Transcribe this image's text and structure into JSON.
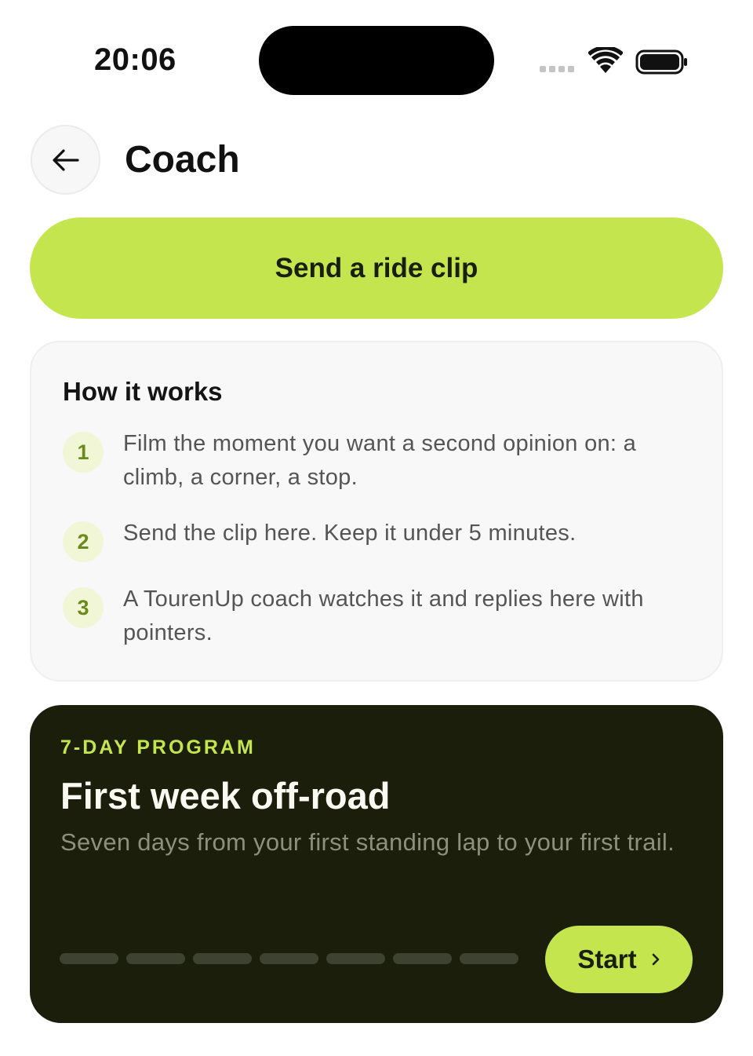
{
  "status_bar": {
    "time": "20:06",
    "signal_icon": "signal-dots-icon",
    "wifi_icon": "wifi-icon",
    "battery_icon": "battery-full-icon"
  },
  "header": {
    "back_icon": "arrow-left-icon",
    "title": "Coach"
  },
  "cta": {
    "label": "Send a ride clip"
  },
  "how_it_works": {
    "title": "How it works",
    "steps": [
      {
        "number": "1",
        "text": "Film the moment you want a second opinion on: a climb, a corner, a stop."
      },
      {
        "number": "2",
        "text": "Send the clip here. Keep it under 5 minutes."
      },
      {
        "number": "3",
        "text": "A TourenUp coach watches it and replies here with pointers."
      }
    ]
  },
  "program": {
    "eyebrow": "7-DAY PROGRAM",
    "title": "First week off-road",
    "description": "Seven days from your first standing lap to your first trail.",
    "days_total": 7,
    "days_completed": 0,
    "start_label": "Start",
    "start_icon": "chevron-right-icon"
  },
  "colors": {
    "accent": "#c5e54e",
    "dark_card": "#1a1e0b",
    "step_badge_bg": "#f1f7d6",
    "step_badge_text": "#6b8a1c"
  }
}
